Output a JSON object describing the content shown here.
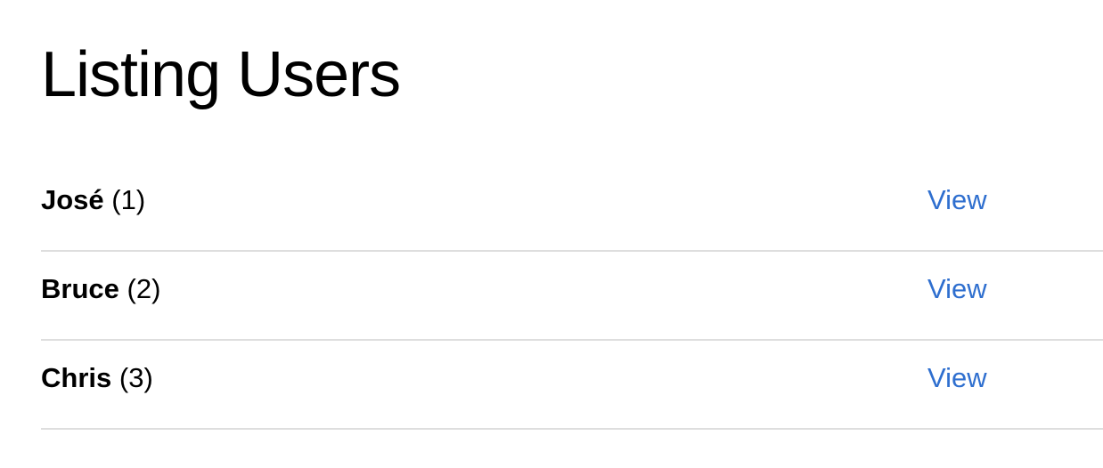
{
  "page": {
    "title": "Listing Users"
  },
  "colors": {
    "link": "#2f6fcf",
    "divider": "#dedede",
    "text": "#000000"
  },
  "users": [
    {
      "name": "José",
      "id": "(1)",
      "action": "View"
    },
    {
      "name": "Bruce",
      "id": "(2)",
      "action": "View"
    },
    {
      "name": "Chris",
      "id": "(3)",
      "action": "View"
    }
  ]
}
